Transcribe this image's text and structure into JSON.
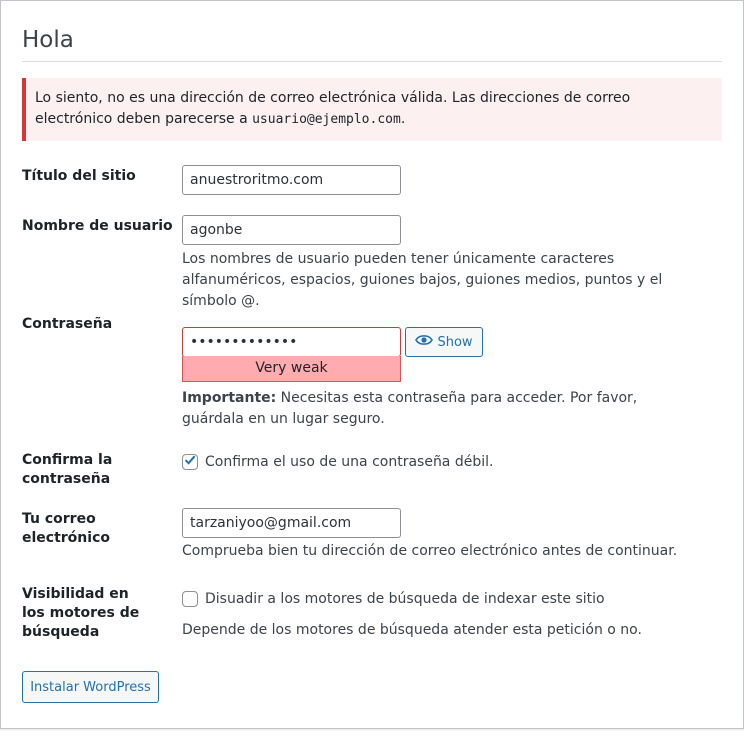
{
  "page": {
    "title": "Hola"
  },
  "notice": {
    "text_before": "Lo siento, no es una dirección de correo electrónica válida. Las direcciones de correo electrónico deben parecerse a ",
    "example": "usuario@ejemplo.com",
    "text_after": "."
  },
  "site_title": {
    "label": "Título del sitio",
    "value": "anuestroritmo.com"
  },
  "username": {
    "label": "Nombre de usuario",
    "value": "agonbe",
    "description": "Los nombres de usuario pueden tener únicamente caracteres alfanuméricos, espacios, guiones bajos, guiones medios, puntos y el símbolo @."
  },
  "password": {
    "label": "Contraseña",
    "value": "•••••••••••••",
    "show_label": "Show",
    "show_icon": "eye-icon",
    "strength": "Very weak",
    "important_strong": "Importante:",
    "important_text": " Necesitas esta contraseña para acceder. Por favor, guárdala en un lugar seguro."
  },
  "confirm_password": {
    "label": "Confirma la contraseña",
    "checkbox_label": "Confirma el uso de una contraseña débil.",
    "checked": true
  },
  "email": {
    "label": "Tu correo electrónico",
    "value": "tarzaniyoo@gmail.com",
    "description": "Comprueba bien tu dirección de correo electrónico antes de continuar."
  },
  "search_visibility": {
    "label": "Visibilidad en los motores de búsqueda",
    "checkbox_label": "Disuadir a los motores de búsqueda de indexar este sitio",
    "checked": false,
    "description": "Depende de los motores de búsqueda atender esta petición o no."
  },
  "install_button": {
    "label": "Instalar WordPress"
  },
  "colors": {
    "accent": "#2271b1",
    "error": "#d63638",
    "weak_bg": "#ffabaf"
  }
}
